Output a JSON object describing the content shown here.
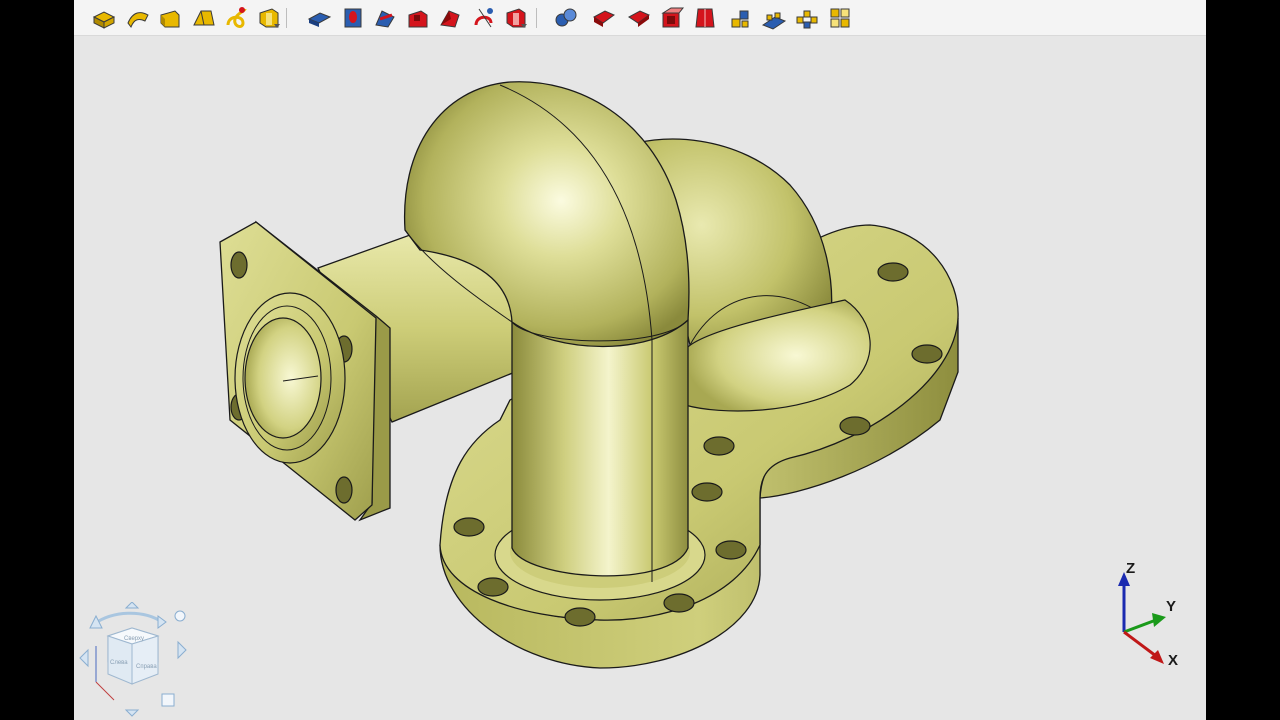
{
  "toolbar": {
    "buttons": [
      {
        "name": "extrude-icon",
        "color": "#e8b800"
      },
      {
        "name": "sweep-icon",
        "color": "#e8b800"
      },
      {
        "name": "rotate-icon",
        "color": "#e8b800"
      },
      {
        "name": "loft-icon",
        "color": "#e8b800"
      },
      {
        "name": "spiral-icon",
        "color": "#e8b800"
      },
      {
        "name": "body-options-icon",
        "color": "#e8b800"
      },
      {
        "name": "boolean-icon",
        "color": "#2a5db0"
      },
      {
        "name": "hole-icon",
        "color": "#2a5db0"
      },
      {
        "name": "rib-icon",
        "color": "#2a5db0"
      },
      {
        "name": "cut-extrude-icon",
        "color": "#d4141c"
      },
      {
        "name": "cut-rotate-icon",
        "color": "#d4141c"
      },
      {
        "name": "cut-sweep-icon",
        "color": "#d4141c"
      },
      {
        "name": "cut-options-icon",
        "color": "#d4141c"
      },
      {
        "name": "fillet-icon",
        "color": "#2a5db0"
      },
      {
        "name": "chamfer-icon",
        "color": "#d4141c"
      },
      {
        "name": "shell-icon",
        "color": "#d4141c"
      },
      {
        "name": "draft-icon",
        "color": "#d4141c"
      },
      {
        "name": "split-icon",
        "color": "#d4141c"
      },
      {
        "name": "array-icon",
        "color": "#2a5db0"
      },
      {
        "name": "linear-array-icon",
        "color": "#2a5db0"
      },
      {
        "name": "circular-array-icon",
        "color": "#e8b800"
      },
      {
        "name": "mirror-array-icon",
        "color": "#e8b800"
      }
    ]
  },
  "model": {
    "body_color": "#cccc7a",
    "edge_color": "#1a1a1a"
  },
  "axes": {
    "x_label": "X",
    "y_label": "Y",
    "z_label": "Z",
    "x_color": "#c01818",
    "y_color": "#1a9a1a",
    "z_color": "#1a2ab0"
  },
  "view_cube": {
    "faces": [
      "Сверху",
      "Слева",
      "Справа"
    ]
  }
}
